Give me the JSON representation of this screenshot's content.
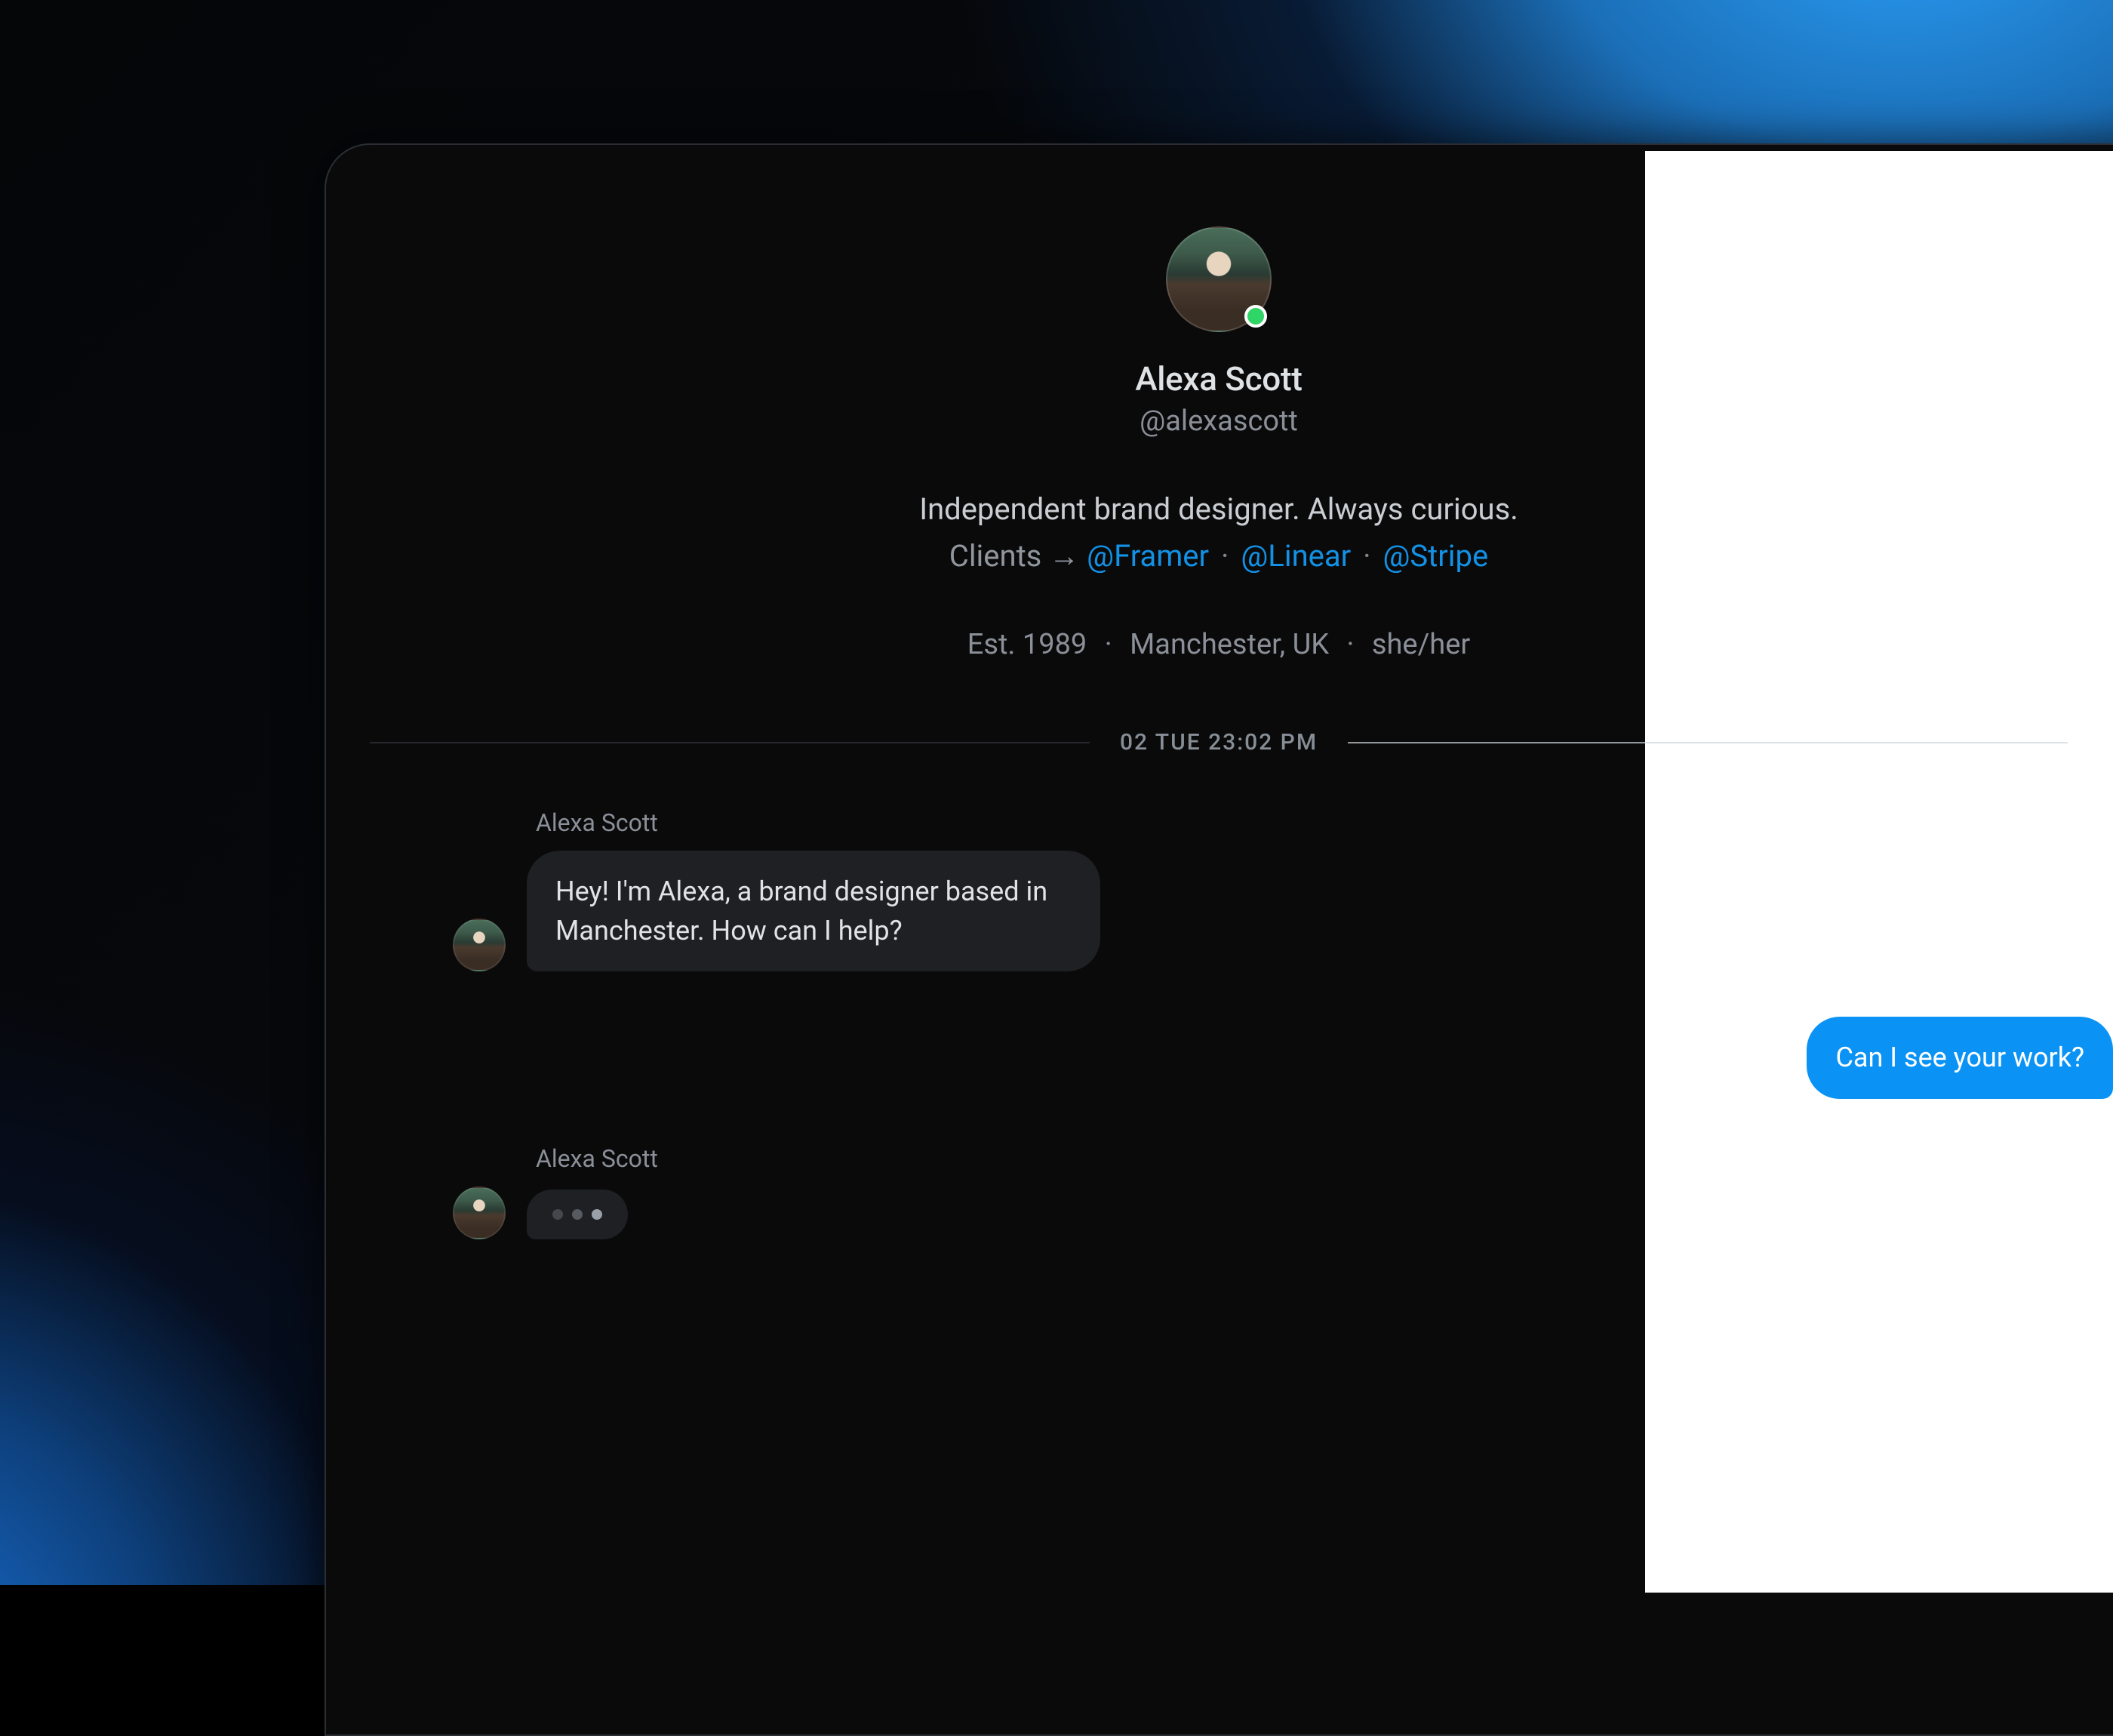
{
  "profile": {
    "display_name": "Alexa Scott",
    "handle": "@alexascott",
    "bio_line1": "Independent brand designer. Always curious.",
    "bio_prefix": "Clients →",
    "clients": [
      {
        "label": "@Framer"
      },
      {
        "label": "@Linear"
      },
      {
        "label": "@Stripe"
      }
    ],
    "meta": {
      "est": "Est. 1989",
      "location": "Manchester, UK",
      "pronouns": "she/her"
    },
    "presence": "online"
  },
  "timeline": {
    "divider": "02 TUE 23:02 PM"
  },
  "messages": {
    "m1": {
      "sender": "Alexa Scott",
      "text": "Hey! I'm Alexa, a brand designer based in Manchester. How can I help?"
    },
    "m2": {
      "text": "Can I see your work?"
    },
    "m3": {
      "sender": "Alexa Scott",
      "typing": true
    }
  },
  "colors": {
    "accent": "#0a93f5",
    "link": "#1d9bf0",
    "presence": "#2fd566"
  }
}
